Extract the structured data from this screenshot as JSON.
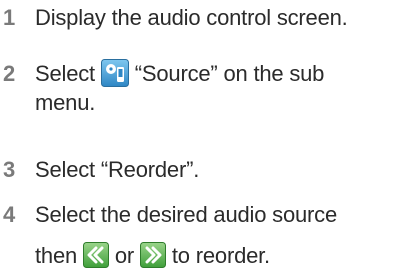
{
  "steps": [
    {
      "number": "1",
      "text": "Display the audio control screen."
    },
    {
      "number": "2",
      "before": "Select",
      "after": "“Source” on the sub",
      "line2": "menu.",
      "icon": "source-menu-icon"
    },
    {
      "number": "3",
      "text": "Select “Reorder”."
    },
    {
      "number": "4",
      "line1": "Select the desired audio source",
      "line2_start": "then",
      "connector": "or",
      "line2_end": "to reorder.",
      "icons": [
        "move-up-icon",
        "move-down-icon"
      ]
    }
  ],
  "colors": {
    "text": "#2b2b2b",
    "step_number": "#7a7a7a",
    "icon_green": "#3f9f3a",
    "icon_blue": "#3d87c8"
  }
}
